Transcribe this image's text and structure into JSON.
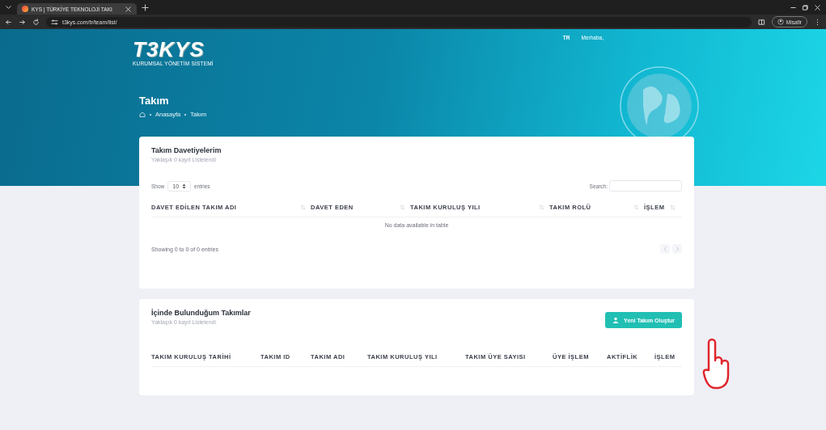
{
  "browser": {
    "tab_title": "KYS | TÜRKİYE TEKNOLOJİ TAKI",
    "address": "t3kys.com/tr/team/list/",
    "profile": "Misafir"
  },
  "header": {
    "logo": "T3KYS",
    "logo_tagline": "KURUMSAL YÖNETİM SİSTEMİ",
    "language": "TR",
    "greeting": "Merhaba,"
  },
  "page": {
    "title": "Takım",
    "breadcrumb": [
      "Anasayfa",
      "Takım"
    ]
  },
  "invitations": {
    "title": "Takım Davetiyelerim",
    "subtitle": "Yaklaşık 0 kayıt Listelendi",
    "show_label": "Show",
    "page_size": "10",
    "entries_label": "entries",
    "search_label": "Search:",
    "columns": [
      "DAVET EDİLEN TAKIM ADI",
      "DAVET EDEN",
      "TAKIM KURULUŞ YILI",
      "TAKIM ROLÜ",
      "İŞLEM"
    ],
    "empty": "No data available in table",
    "info": "Showing 0 to 0 of 0 entries"
  },
  "teams": {
    "title": "İçinde Bulunduğum Takımlar",
    "subtitle": "Yaklaşık 0 kayıt Listelendi",
    "button": "Yeni Takım Oluştur",
    "columns": [
      "TAKIM KURULUŞ TARİHİ",
      "TAKIM ID",
      "TAKIM ADI",
      "TAKIM KURULUŞ YILI",
      "TAKIM ÜYE SAYISI",
      "ÜYE İŞLEM",
      "AKTİFLİK",
      "İŞLEM"
    ]
  }
}
